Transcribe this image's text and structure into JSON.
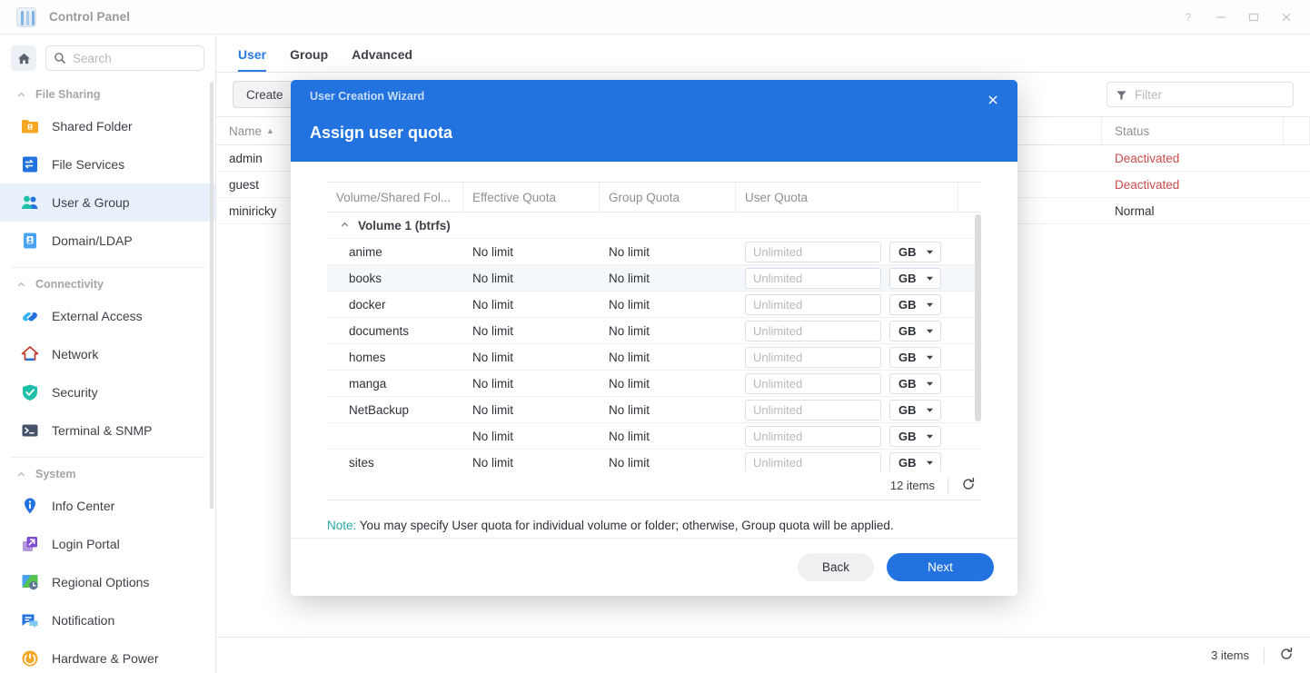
{
  "window": {
    "title": "Control Panel",
    "icon": "control-panel-icon",
    "controls": [
      {
        "name": "help-button",
        "glyph": "?"
      },
      {
        "name": "minimize-button",
        "glyph": "—"
      },
      {
        "name": "maximize-button",
        "glyph": "▭"
      },
      {
        "name": "close-button",
        "glyph": "✕"
      }
    ]
  },
  "sidebar": {
    "home_icon": "home-icon",
    "search": {
      "placeholder": "Search",
      "value": "",
      "icon": "search-icon"
    },
    "groups": [
      {
        "label": "File Sharing",
        "items": [
          {
            "label": "Shared Folder",
            "icon": "shared-folder-icon",
            "active": false
          },
          {
            "label": "File Services",
            "icon": "file-services-icon",
            "active": false
          },
          {
            "label": "User & Group",
            "icon": "user-group-icon",
            "active": true
          },
          {
            "label": "Domain/LDAP",
            "icon": "domain-ldap-icon",
            "active": false
          }
        ]
      },
      {
        "label": "Connectivity",
        "items": [
          {
            "label": "External Access",
            "icon": "external-access-icon",
            "active": false
          },
          {
            "label": "Network",
            "icon": "network-icon",
            "active": false
          },
          {
            "label": "Security",
            "icon": "security-icon",
            "active": false
          },
          {
            "label": "Terminal & SNMP",
            "icon": "terminal-snmp-icon",
            "active": false
          }
        ]
      },
      {
        "label": "System",
        "items": [
          {
            "label": "Info Center",
            "icon": "info-center-icon",
            "active": false
          },
          {
            "label": "Login Portal",
            "icon": "login-portal-icon",
            "active": false
          },
          {
            "label": "Regional Options",
            "icon": "regional-options-icon",
            "active": false
          },
          {
            "label": "Notification",
            "icon": "notification-icon",
            "active": false
          },
          {
            "label": "Hardware & Power",
            "icon": "hardware-power-icon",
            "active": false
          }
        ]
      }
    ]
  },
  "main": {
    "tabs": [
      {
        "label": "User",
        "active": true
      },
      {
        "label": "Group",
        "active": false
      },
      {
        "label": "Advanced",
        "active": false
      }
    ],
    "toolbar": {
      "create_label": "Create",
      "filter": {
        "placeholder": "Filter",
        "value": "",
        "icon": "filter-icon"
      }
    },
    "table": {
      "columns": [
        "Name",
        "",
        "Status",
        ""
      ],
      "sort_column": "Name",
      "sort_direction": "ascending",
      "rows": [
        {
          "name": "admin",
          "description": "",
          "status": "Deactivated",
          "status_state": "deactivated"
        },
        {
          "name": "guest",
          "description": "",
          "status": "Deactivated",
          "status_state": "deactivated"
        },
        {
          "name": "miniricky",
          "description": "",
          "status": "Normal",
          "status_state": "normal"
        }
      ]
    },
    "statusbar": {
      "items_text": "3 items",
      "refresh_icon": "refresh-icon"
    }
  },
  "modal": {
    "wizard_label": "User Creation Wizard",
    "title": "Assign user quota",
    "close_icon": "close-icon",
    "table": {
      "columns": [
        "Volume/Shared Fol...",
        "Effective Quota",
        "Group Quota",
        "User Quota",
        ""
      ],
      "group": {
        "label": "Volume 1 (btrfs)",
        "expanded": true
      },
      "rows": [
        {
          "name": "anime",
          "effective_quota": "No limit",
          "group_quota": "No limit",
          "user_quota_value": "",
          "user_quota_placeholder": "Unlimited",
          "unit": "GB"
        },
        {
          "name": "books",
          "effective_quota": "No limit",
          "group_quota": "No limit",
          "user_quota_value": "",
          "user_quota_placeholder": "Unlimited",
          "unit": "GB"
        },
        {
          "name": "docker",
          "effective_quota": "No limit",
          "group_quota": "No limit",
          "user_quota_value": "",
          "user_quota_placeholder": "Unlimited",
          "unit": "GB"
        },
        {
          "name": "documents",
          "effective_quota": "No limit",
          "group_quota": "No limit",
          "user_quota_value": "",
          "user_quota_placeholder": "Unlimited",
          "unit": "GB"
        },
        {
          "name": "homes",
          "effective_quota": "No limit",
          "group_quota": "No limit",
          "user_quota_value": "",
          "user_quota_placeholder": "Unlimited",
          "unit": "GB"
        },
        {
          "name": "manga",
          "effective_quota": "No limit",
          "group_quota": "No limit",
          "user_quota_value": "",
          "user_quota_placeholder": "Unlimited",
          "unit": "GB"
        },
        {
          "name": "NetBackup",
          "effective_quota": "No limit",
          "group_quota": "No limit",
          "user_quota_value": "",
          "user_quota_placeholder": "Unlimited",
          "unit": "GB"
        },
        {
          "name": "",
          "effective_quota": "No limit",
          "group_quota": "No limit",
          "user_quota_value": "",
          "user_quota_placeholder": "Unlimited",
          "unit": "GB"
        },
        {
          "name": "sites",
          "effective_quota": "No limit",
          "group_quota": "No limit",
          "user_quota_value": "",
          "user_quota_placeholder": "Unlimited",
          "unit": "GB"
        }
      ],
      "footer": {
        "items_text": "12 items",
        "refresh_icon": "refresh-icon"
      }
    },
    "note": {
      "label": "Note:",
      "text": "You may specify User quota for individual volume or folder; otherwise, Group quota will be applied."
    },
    "buttons": {
      "back": "Back",
      "next": "Next"
    }
  },
  "colors": {
    "accent": "#2272e0",
    "danger": "#c94b4b",
    "note": "#2aa8a8",
    "active_nav_bg": "#e8f1fb"
  }
}
